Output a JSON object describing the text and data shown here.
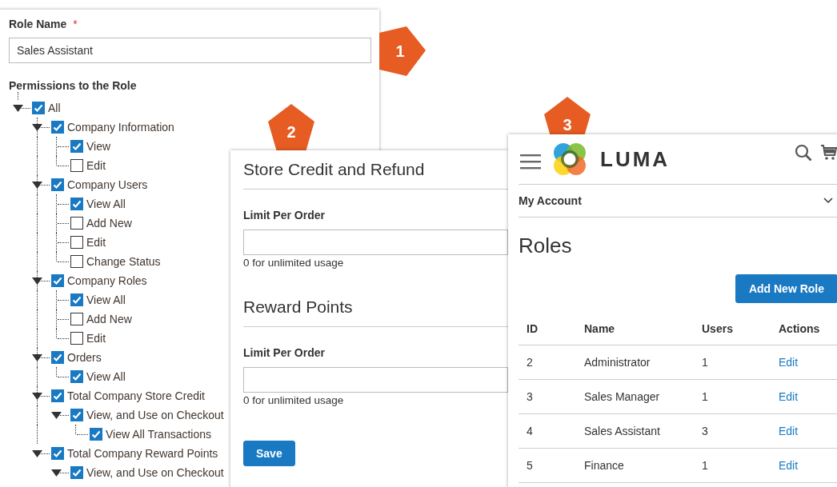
{
  "role_form": {
    "label": "Role Name",
    "required_mark": "*",
    "value": "Sales Assistant",
    "permissions_title": "Permissions to the Role",
    "tree": [
      {
        "label": "All",
        "checked": true,
        "expanded": true,
        "children": [
          {
            "label": "Company Information",
            "checked": true,
            "expanded": true,
            "children": [
              {
                "label": "View",
                "checked": true
              },
              {
                "label": "Edit",
                "checked": false
              }
            ]
          },
          {
            "label": "Company Users",
            "checked": true,
            "expanded": true,
            "children": [
              {
                "label": "View All",
                "checked": true
              },
              {
                "label": "Add New",
                "checked": false
              },
              {
                "label": "Edit",
                "checked": false
              },
              {
                "label": "Change Status",
                "checked": false
              }
            ]
          },
          {
            "label": "Company Roles",
            "checked": true,
            "expanded": true,
            "children": [
              {
                "label": "View All",
                "checked": true
              },
              {
                "label": "Add New",
                "checked": false
              },
              {
                "label": "Edit",
                "checked": false
              }
            ]
          },
          {
            "label": "Orders",
            "checked": true,
            "expanded": true,
            "children": [
              {
                "label": "View All",
                "checked": true
              }
            ]
          },
          {
            "label": "Total Company Store Credit",
            "checked": true,
            "expanded": true,
            "children": [
              {
                "label": "View, and Use on Checkout",
                "checked": true,
                "expanded": true,
                "children": [
                  {
                    "label": "View All Transactions",
                    "checked": true
                  }
                ]
              }
            ]
          },
          {
            "label": "Total Company Reward Points",
            "checked": true,
            "expanded": true,
            "children": [
              {
                "label": "View, and Use on Checkout",
                "checked": true,
                "expanded": true
              }
            ]
          }
        ]
      }
    ]
  },
  "callouts": [
    {
      "label": "1",
      "kind": "right"
    },
    {
      "label": "2",
      "kind": "up"
    },
    {
      "label": "3",
      "kind": "up"
    }
  ],
  "credit_panel": {
    "sections": [
      {
        "title": "Store Credit and Refund",
        "field_label": "Limit Per Order",
        "hint": "0 for unlimited usage"
      },
      {
        "title": "Reward Points",
        "field_label": "Limit Per Order",
        "hint": "0 for unlimited usage"
      }
    ],
    "save_button": "Save"
  },
  "storefront": {
    "logo_text": "LUMA",
    "account_menu": "My Account",
    "heading": "Roles",
    "add_button": "Add New Role",
    "table": {
      "columns": [
        "ID",
        "Name",
        "Users",
        "Actions"
      ],
      "rows": [
        [
          "2",
          "Administrator",
          "1",
          "Edit"
        ],
        [
          "3",
          "Sales Manager",
          "1",
          "Edit"
        ],
        [
          "4",
          "Sales Assistant",
          "3",
          "Edit"
        ],
        [
          "5",
          "Finance",
          "1",
          "Edit"
        ]
      ]
    }
  }
}
